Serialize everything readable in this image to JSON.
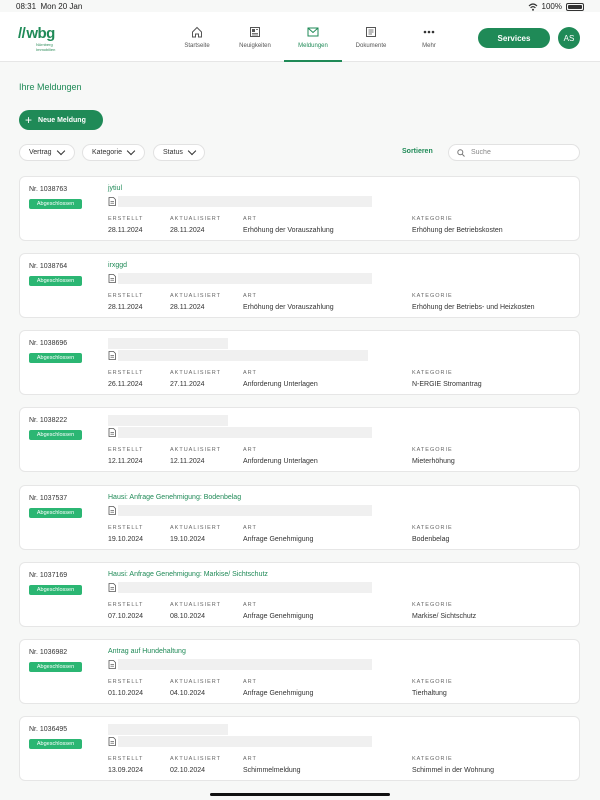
{
  "statusbar": {
    "time": "08:31",
    "date": "Mon 20 Jan",
    "battery": "100%"
  },
  "logo": {
    "brand": "wbg",
    "sub1": "Nürnberg",
    "sub2": "Immobilien"
  },
  "nav": [
    {
      "label": "Startseite",
      "icon": "home-icon"
    },
    {
      "label": "Neuigkeiten",
      "icon": "news-icon"
    },
    {
      "label": "Meldungen",
      "icon": "mail-icon",
      "active": true
    },
    {
      "label": "Dokumente",
      "icon": "document-icon"
    },
    {
      "label": "Mehr",
      "icon": "more-icon"
    }
  ],
  "header": {
    "services_label": "Services",
    "avatar_initials": "AS"
  },
  "page": {
    "title": "Ihre Meldungen",
    "new_button": "Neue Meldung",
    "filters": {
      "vertrag": "Vertrag",
      "kategorie": "Kategorie",
      "status": "Status"
    },
    "sort_label": "Sortieren",
    "search_placeholder": "Suche"
  },
  "labels": {
    "erstellt": "ERSTELLT",
    "aktualisiert": "AKTUALISIERT",
    "art": "ART",
    "kategorie": "KATEGORIE"
  },
  "colors": {
    "accent": "#1f8a57",
    "badge": "#2bb673"
  },
  "reports": [
    {
      "nr": "Nr. 1038763",
      "status": "Abgeschlossen",
      "title": "jytiul",
      "erstellt": "28.11.2024",
      "aktualisiert": "28.11.2024",
      "art": "Erhöhung der Vorauszahlung",
      "kategorie": "Erhöhung der Betriebskosten"
    },
    {
      "nr": "Nr. 1038764",
      "status": "Abgeschlossen",
      "title": "irxggd",
      "erstellt": "28.11.2024",
      "aktualisiert": "28.11.2024",
      "art": "Erhöhung der Vorauszahlung",
      "kategorie": "Erhöhung der Betriebs- und Heizkosten"
    },
    {
      "nr": "Nr. 1038696",
      "status": "Abgeschlossen",
      "title": "",
      "erstellt": "26.11.2024",
      "aktualisiert": "27.11.2024",
      "art": "Anforderung Unterlagen",
      "kategorie": "N-ERGIE Stromantrag"
    },
    {
      "nr": "Nr. 1038222",
      "status": "Abgeschlossen",
      "title": "",
      "erstellt": "12.11.2024",
      "aktualisiert": "12.11.2024",
      "art": "Anforderung Unterlagen",
      "kategorie": "Mieterhöhung"
    },
    {
      "nr": "Nr. 1037537",
      "status": "Abgeschlossen",
      "title": "Hausi: Anfrage Genehmigung: Bodenbelag",
      "erstellt": "19.10.2024",
      "aktualisiert": "19.10.2024",
      "art": "Anfrage Genehmigung",
      "kategorie": "Bodenbelag"
    },
    {
      "nr": "Nr. 1037169",
      "status": "Abgeschlossen",
      "title": "Hausi: Anfrage Genehmigung: Markise/ Sichtschutz",
      "erstellt": "07.10.2024",
      "aktualisiert": "08.10.2024",
      "art": "Anfrage Genehmigung",
      "kategorie": "Markise/ Sichtschutz"
    },
    {
      "nr": "Nr. 1036982",
      "status": "Abgeschlossen",
      "title": "Antrag auf Hundehaltung",
      "erstellt": "01.10.2024",
      "aktualisiert": "04.10.2024",
      "art": "Anfrage Genehmigung",
      "kategorie": "Tierhaltung"
    },
    {
      "nr": "Nr. 1036495",
      "status": "Abgeschlossen",
      "title": "",
      "erstellt": "13.09.2024",
      "aktualisiert": "02.10.2024",
      "art": "Schimmelmeldung",
      "kategorie": "Schimmel in der Wohnung"
    }
  ]
}
